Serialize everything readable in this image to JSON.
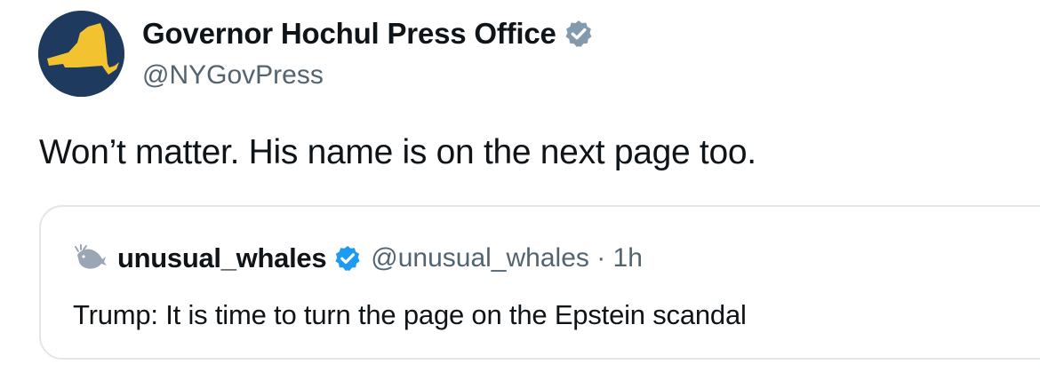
{
  "post": {
    "author": {
      "display_name": "Governor Hochul Press Office",
      "handle": "@NYGovPress",
      "verified_badge": "gray-verified-badge-icon",
      "avatar": "new-york-state-silhouette-logo",
      "avatar_colors": {
        "background": "#1f3a5f",
        "state": "#f2c230"
      }
    },
    "text": "Won’t matter. His name is on the next page too."
  },
  "quoted_post": {
    "author": {
      "display_name": "unusual_whales",
      "handle_time": "@unusual_whales · 1h",
      "verified_badge": "blue-verified-badge-icon",
      "avatar": "whale-logo-icon"
    },
    "text": "Trump: It is time to turn the page on the Epstein scandal"
  },
  "colors": {
    "text_primary": "#0f1419",
    "text_secondary": "#536471",
    "verified_blue": "#1d9bf0",
    "verified_gray": "#829aab",
    "border": "#e1e6ea"
  }
}
